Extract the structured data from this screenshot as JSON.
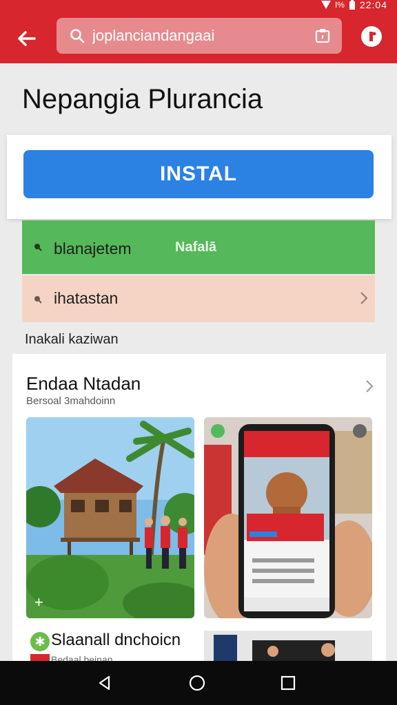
{
  "status_bar": {
    "time": "22:04",
    "signal_text": "I%"
  },
  "app_bar": {
    "search_value": "joplanciandangaai",
    "back_icon": "arrow-left-icon",
    "search_icon": "search-icon",
    "clipboard_icon": "clipboard-icon",
    "info_icon": "info-icon"
  },
  "page": {
    "title": "Nepangia Plurancia"
  },
  "install": {
    "label": "INSTAL"
  },
  "rows": [
    {
      "label": "blanajetem",
      "badge": "Nafalā",
      "color": "#55b85a"
    },
    {
      "label": "ihatastan",
      "color": "#f6d4c5"
    }
  ],
  "section_label": "Inakali kaziwan",
  "feed": {
    "title": "Endaa Ntadan",
    "subtitle": "Bersoal 3mahdoinn",
    "item_title": "Slaanall dnchoicn",
    "item_subtitle": "Bedaal beinan"
  },
  "colors": {
    "brand_red": "#d7262d",
    "install_blue": "#2b82e3",
    "row_green": "#55b85a",
    "row_peach": "#f6d4c5"
  }
}
